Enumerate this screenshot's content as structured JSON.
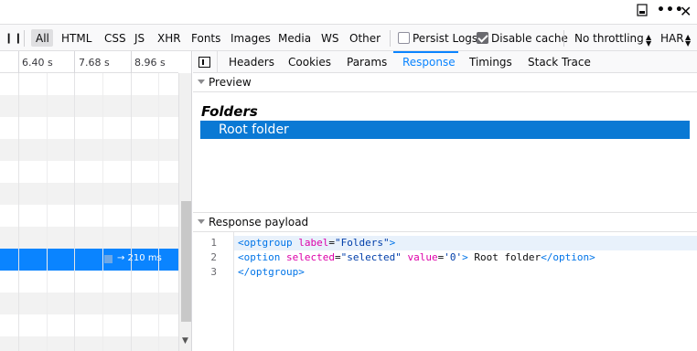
{
  "window": {
    "dock_icon": "dock-side-icon",
    "menu_icon": "more-menu-icon",
    "close_icon": "close-icon"
  },
  "toolbar": {
    "pause_glyph": "❙❙",
    "filters": [
      "All",
      "HTML",
      "CSS",
      "JS",
      "XHR",
      "Fonts",
      "Images",
      "Media",
      "WS",
      "Other"
    ],
    "active_filter": "All",
    "persist_logs": {
      "label": "Persist Logs",
      "checked": false
    },
    "disable_cache": {
      "label": "Disable cache",
      "checked": true
    },
    "throttling": "No throttling",
    "har": "HAR"
  },
  "waterfall": {
    "ticks": [
      "6.40 s",
      "7.68 s",
      "8.96 s"
    ],
    "selected_timing": "→ 210 ms"
  },
  "details": {
    "tabs": [
      "Headers",
      "Cookies",
      "Params",
      "Response",
      "Timings",
      "Stack Trace"
    ],
    "active_tab": "Response",
    "preview_label": "Preview",
    "preview": {
      "optgroup_label": "Folders",
      "option": "Root folder"
    },
    "payload_label": "Response payload",
    "line_numbers": [
      "1",
      "2",
      "3"
    ]
  },
  "colors": {
    "accent": "#0a84ff",
    "selected_option": "#0a79d4"
  }
}
